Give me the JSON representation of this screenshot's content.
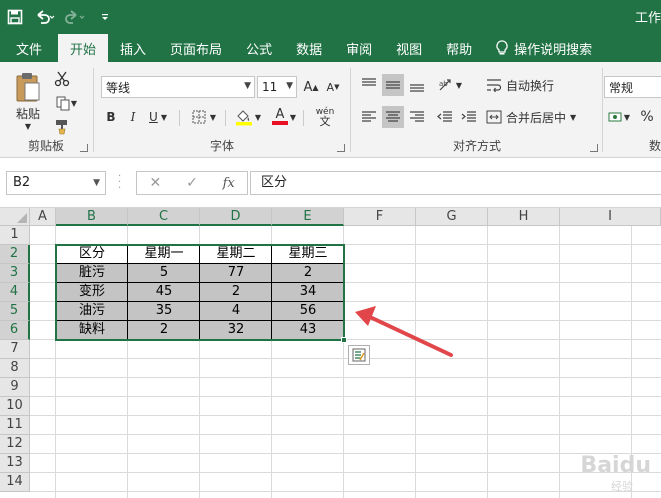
{
  "titlebar": {
    "title": "工作"
  },
  "tabs": [
    "文件",
    "开始",
    "插入",
    "页面布局",
    "公式",
    "数据",
    "审阅",
    "视图",
    "帮助"
  ],
  "active_tab": "开始",
  "tell_me": "操作说明搜索",
  "clipboard": {
    "paste_label": "粘贴",
    "group_label": "剪贴板"
  },
  "font": {
    "name": "等线",
    "size": "11",
    "group_label": "字体",
    "bold": "B",
    "italic": "I",
    "underline": "U",
    "grow": "A",
    "shrink": "A",
    "font_color": "A",
    "wen": "wén"
  },
  "alignment": {
    "wrap_label": "自动换行",
    "merge_label": "合并后居中",
    "group_label": "对齐方式"
  },
  "number": {
    "format": "常规",
    "group_label": "数"
  },
  "formula_bar": {
    "name_box": "B2",
    "content": "区分",
    "fx": "fx",
    "cancel": "✕",
    "confirm": "✓"
  },
  "columns": [
    "A",
    "B",
    "C",
    "D",
    "E",
    "F",
    "G",
    "H",
    "I"
  ],
  "rows": [
    "1",
    "2",
    "3",
    "4",
    "5",
    "6",
    "7",
    "8",
    "9",
    "10",
    "11",
    "12",
    "13",
    "14"
  ],
  "table": {
    "header": [
      "区分",
      "星期一",
      "星期二",
      "星期三"
    ],
    "rows": [
      [
        "脏污",
        "5",
        "77",
        "2"
      ],
      [
        "变形",
        "45",
        "2",
        "34"
      ],
      [
        "油污",
        "35",
        "4",
        "56"
      ],
      [
        "缺料",
        "2",
        "32",
        "43"
      ]
    ]
  },
  "colors": {
    "excel_green": "#217346",
    "arrow_red": "#e0464a",
    "cell_gray": "#c4c4c4"
  },
  "watermark": {
    "brand": "Baidu",
    "sub": "经验"
  }
}
